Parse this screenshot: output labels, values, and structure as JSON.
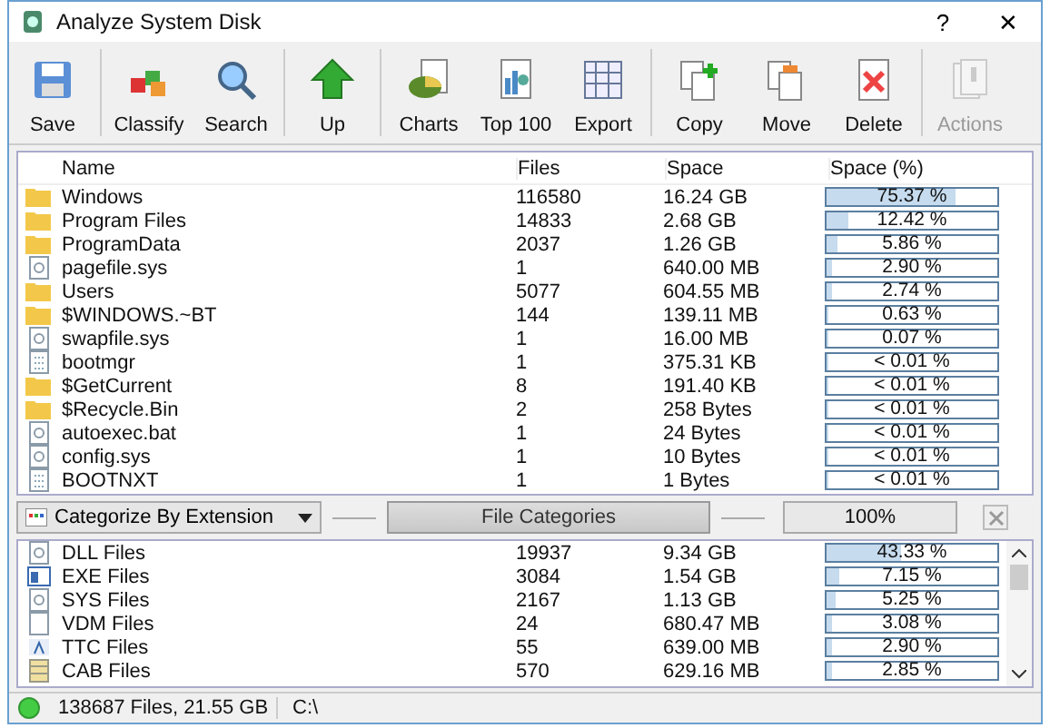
{
  "window": {
    "title": "Analyze System Disk",
    "help": "?",
    "close": "✕"
  },
  "toolbar": {
    "groups": [
      [
        {
          "label": "Save",
          "disabled": false
        }
      ],
      [
        {
          "label": "Classify",
          "disabled": false
        },
        {
          "label": "Search",
          "disabled": false
        }
      ],
      [
        {
          "label": "Up",
          "disabled": false
        }
      ],
      [
        {
          "label": "Charts",
          "disabled": false
        },
        {
          "label": "Top 100",
          "disabled": false
        },
        {
          "label": "Export",
          "disabled": false
        }
      ],
      [
        {
          "label": "Copy",
          "disabled": false
        },
        {
          "label": "Move",
          "disabled": false
        },
        {
          "label": "Delete",
          "disabled": false
        }
      ],
      [
        {
          "label": "Actions",
          "disabled": true
        }
      ]
    ]
  },
  "table": {
    "columns": [
      "Name",
      "Files",
      "Space",
      "Space (%)"
    ],
    "rows": [
      {
        "kind": "folder",
        "name": "Windows",
        "files": "116580",
        "space": "16.24 GB",
        "percent": "75.37 %",
        "level": 0.7537
      },
      {
        "kind": "folder",
        "name": "Program Files",
        "files": "14833",
        "space": "2.68 GB",
        "percent": "12.42 %",
        "level": 0.1242
      },
      {
        "kind": "folder",
        "name": "ProgramData",
        "files": "2037",
        "space": "1.26 GB",
        "percent": "5.86 %",
        "level": 0.0586
      },
      {
        "kind": "sysfile",
        "name": "pagefile.sys",
        "files": "1",
        "space": "640.00 MB",
        "percent": "2.90 %",
        "level": 0.029
      },
      {
        "kind": "folder",
        "name": "Users",
        "files": "5077",
        "space": "604.55 MB",
        "percent": "2.74 %",
        "level": 0.0274
      },
      {
        "kind": "folder",
        "name": "$WINDOWS.~BT",
        "files": "144",
        "space": "139.11 MB",
        "percent": "0.63 %",
        "level": 0.0063
      },
      {
        "kind": "sysfile",
        "name": "swapfile.sys",
        "files": "1",
        "space": "16.00 MB",
        "percent": "0.07 %",
        "level": 0.0007
      },
      {
        "kind": "binfile",
        "name": "bootmgr",
        "files": "1",
        "space": "375.31 KB",
        "percent": "< 0.01 %",
        "level": 0
      },
      {
        "kind": "folder",
        "name": "$GetCurrent",
        "files": "8",
        "space": "191.40 KB",
        "percent": "< 0.01 %",
        "level": 0
      },
      {
        "kind": "folder",
        "name": "$Recycle.Bin",
        "files": "2",
        "space": "258 Bytes",
        "percent": "< 0.01 %",
        "level": 0
      },
      {
        "kind": "sysfile",
        "name": "autoexec.bat",
        "files": "1",
        "space": "24 Bytes",
        "percent": "< 0.01 %",
        "level": 0
      },
      {
        "kind": "sysfile",
        "name": "config.sys",
        "files": "1",
        "space": "10 Bytes",
        "percent": "< 0.01 %",
        "level": 0
      },
      {
        "kind": "binfile",
        "name": "BOOTNXT",
        "files": "1",
        "space": "1 Bytes",
        "percent": "< 0.01 %",
        "level": 0
      }
    ]
  },
  "category_bar": {
    "dropdown": "Categorize By Extension",
    "button": "File Categories",
    "total": "100%"
  },
  "categories": {
    "rows": [
      {
        "kind": "sysfile",
        "name": "DLL Files",
        "files": "19937",
        "space": "9.34 GB",
        "percent": "43.33 %",
        "level": 0.4333
      },
      {
        "kind": "exefile",
        "name": "EXE Files",
        "files": "3084",
        "space": "1.54 GB",
        "percent": "7.15 %",
        "level": 0.0715
      },
      {
        "kind": "sysfile",
        "name": "SYS Files",
        "files": "2167",
        "space": "1.13 GB",
        "percent": "5.25 %",
        "level": 0.0525
      },
      {
        "kind": "blank",
        "name": "VDM Files",
        "files": "24",
        "space": "680.47 MB",
        "percent": "3.08 %",
        "level": 0.0308
      },
      {
        "kind": "fontfile",
        "name": "TTC Files",
        "files": "55",
        "space": "639.00 MB",
        "percent": "2.90 %",
        "level": 0.029
      },
      {
        "kind": "cabfile",
        "name": "CAB Files",
        "files": "570",
        "space": "629.16 MB",
        "percent": "2.85 %",
        "level": 0.0285
      }
    ]
  },
  "status_bar": {
    "summary": "138687 Files, 21.55 GB",
    "path": "C:\\"
  }
}
